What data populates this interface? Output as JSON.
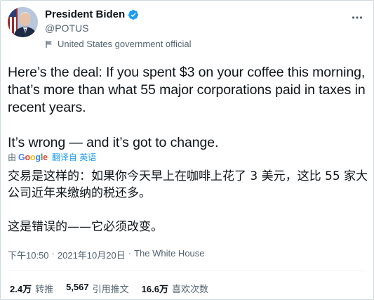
{
  "author": {
    "name": "President Biden",
    "handle": "@POTUS",
    "label": "United States government official"
  },
  "tweet": {
    "paragraphs": [
      "Here’s the deal: If you spent $3 on your coffee this morning, that’s more than what 55 major corporations paid in taxes in recent years.",
      "It’s wrong — and it’s got to change."
    ]
  },
  "translation": {
    "by": "由",
    "provider": "Google",
    "action": "翻译自 英语",
    "paragraphs": [
      "交易是这样的：如果你今天早上在咖啡上花了 3 美元，这比 55 家大公司近年来缴纳的税还多。",
      "这是错误的——它必须改变。"
    ]
  },
  "meta": {
    "time": "下午10:50",
    "separator": "·",
    "date": "2021年10月20日",
    "source": "The White House"
  },
  "stats": {
    "retweets_count": "2.4万",
    "retweets_label": "转推",
    "quotes_count": "5,567",
    "quotes_label": "引用推文",
    "likes_count": "16.6万",
    "likes_label": "喜欢次数"
  },
  "colors": {
    "verified_blue": "#1d9bf0",
    "text_secondary": "#536471"
  }
}
